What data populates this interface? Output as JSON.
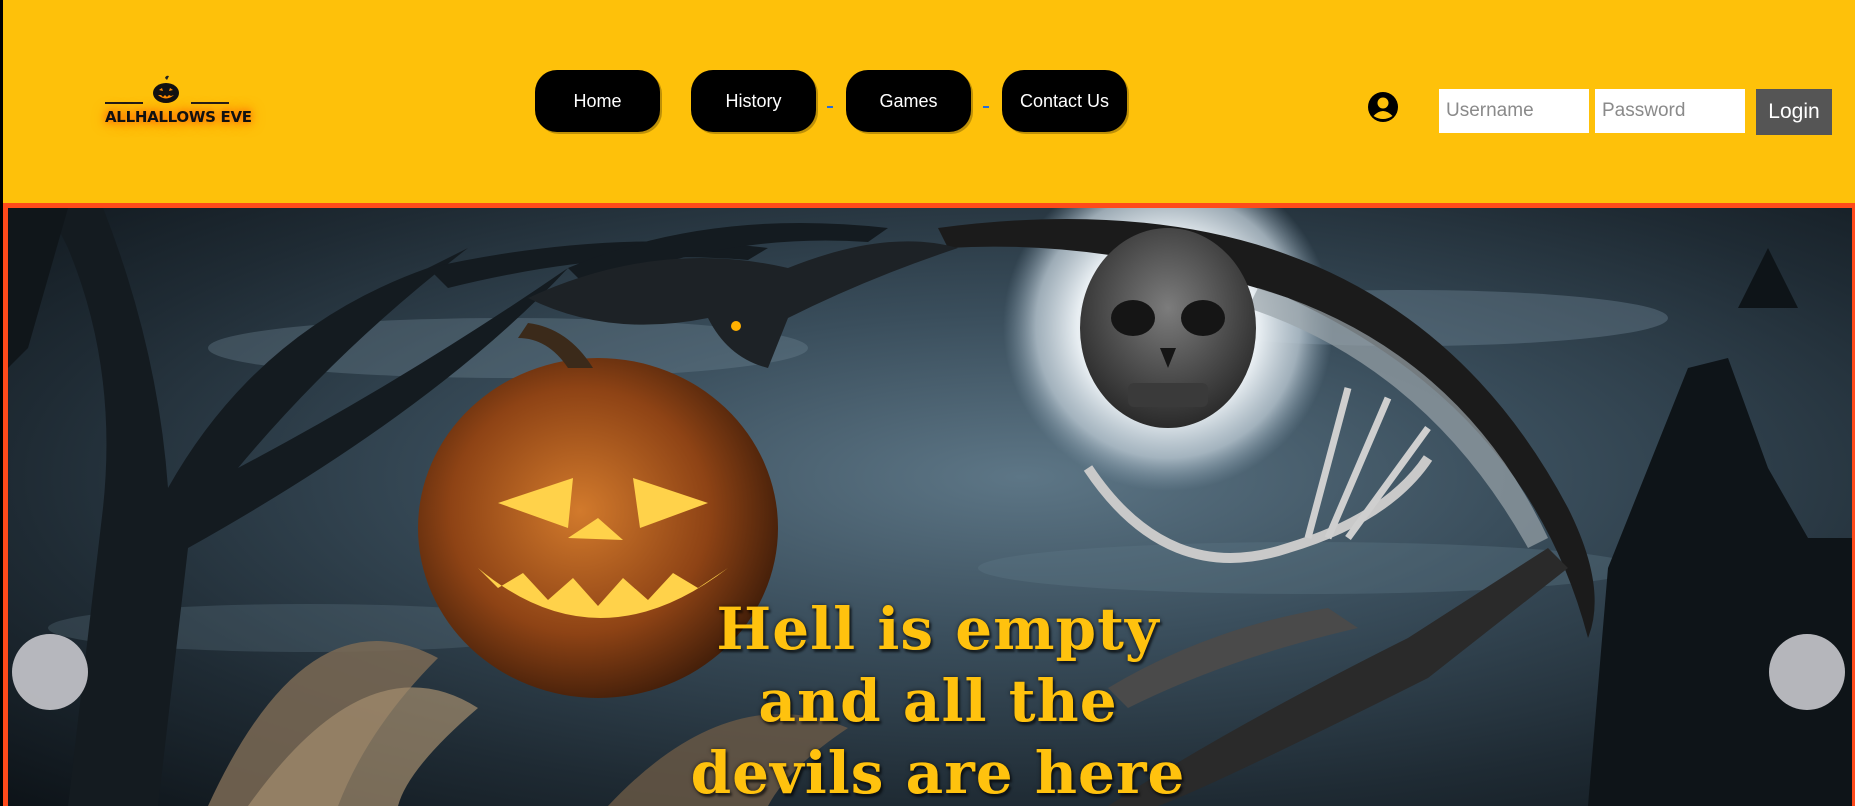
{
  "brand": {
    "logo_text": "ALLHALLOWS EVE"
  },
  "nav": {
    "items": [
      {
        "label": "Home"
      },
      {
        "label": "History"
      },
      {
        "label": "Games"
      },
      {
        "label": "Contact Us"
      }
    ]
  },
  "login": {
    "username_placeholder": "Username",
    "password_placeholder": "Password",
    "button_label": "Login"
  },
  "hero": {
    "quote_lines": [
      "Hell is empty",
      "and all the",
      "devils are here"
    ]
  },
  "colors": {
    "header_bg": "#FEC10A",
    "hero_border": "#FF4A1A",
    "quote_text": "#FFC20E",
    "nav_button_bg": "#000000",
    "login_button_bg": "#555555"
  },
  "icons": {
    "logo": "pumpkin-icon",
    "user": "user-circle-icon",
    "prev": "carousel-prev-arrow",
    "next": "carousel-next-arrow"
  }
}
